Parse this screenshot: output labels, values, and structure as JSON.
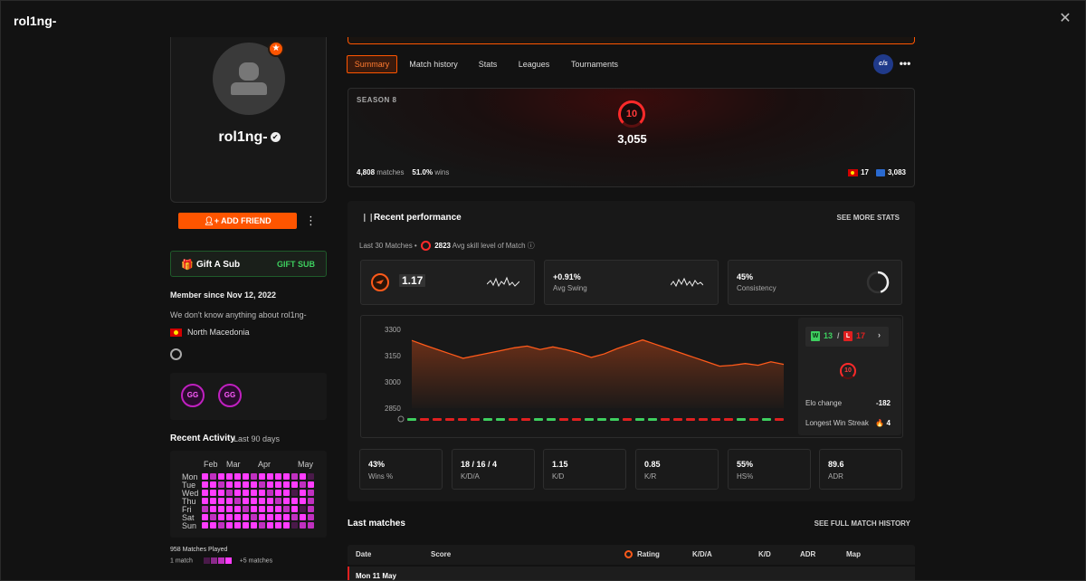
{
  "window": {
    "title": "rol1ng-",
    "close_glyph": "✕"
  },
  "profile": {
    "name": "rol1ng-",
    "verified_glyph": "✔",
    "badge_glyph": "★",
    "add_friend_label": "ADD FRIEND",
    "add_friend_icon": "user-plus-icon",
    "more_glyph": "⋮"
  },
  "gift": {
    "icon_glyph": "🎁",
    "label": "Gift A Sub",
    "action": "GIFT SUB"
  },
  "member_since": "Member since Nov 12, 2022",
  "about": "We don't know anything about rol1ng-",
  "country": "North Macedonia",
  "badges": [
    "GG",
    "GG"
  ],
  "recent_activity": {
    "title": "Recent Activity",
    "subtitle": "Last 90 days",
    "months": [
      "Feb",
      "Mar",
      "Apr",
      "May"
    ],
    "days": [
      "Mon",
      "Tue",
      "Wed",
      "Thu",
      "Fri",
      "Sat",
      "Sun"
    ],
    "matches_played": "958 Matches Played",
    "legend_low": "1 match",
    "legend_high": "+5 matches"
  },
  "tabs": [
    "Summary",
    "Match history",
    "Stats",
    "Leagues",
    "Tournaments"
  ],
  "game_logo": "c/s",
  "more_glyph": "•••",
  "season": {
    "label": "SEASON 8",
    "level": "10",
    "elo": "3,055",
    "matches_value": "4,808",
    "matches_label": "matches",
    "wins_value": "51.0%",
    "wins_label": "wins",
    "rank_country": "17",
    "rank_world": "3,083"
  },
  "performance": {
    "title": "Recent performance",
    "see_more": "SEE MORE STATS",
    "sub_prefix": "Last 30 Matches •",
    "avg_value": "2823",
    "avg_label": "Avg skill level of Match",
    "info_glyph": "ⓘ",
    "metrics": [
      {
        "value": "1.17",
        "label": ""
      },
      {
        "value": "+0.91%",
        "label": "Avg Swing"
      },
      {
        "value": "45%",
        "label": "Consistency"
      }
    ],
    "side": {
      "wins": "13",
      "losses": "17",
      "w_tag": "W",
      "l_tag": "L",
      "sep": "/",
      "arrow": "›",
      "level": "10",
      "elo_change_label": "Elo change",
      "elo_change_value": "-182",
      "streak_label": "Longest Win Streak",
      "streak_value": "🔥 4"
    },
    "stats": [
      {
        "value": "43%",
        "label": "Wins %"
      },
      {
        "value": "18 / 16 / 4",
        "label": "K/D/A"
      },
      {
        "value": "1.15",
        "label": "K/D"
      },
      {
        "value": "0.85",
        "label": "K/R"
      },
      {
        "value": "55%",
        "label": "HS%"
      },
      {
        "value": "89.6",
        "label": "ADR"
      }
    ]
  },
  "chart_data": {
    "type": "area",
    "title": "",
    "xlabel": "",
    "ylabel": "",
    "yticks": [
      "3300",
      "3150",
      "3000",
      "2850"
    ],
    "ylim": [
      2850,
      3300
    ],
    "values": [
      3237,
      3210,
      3185,
      3160,
      3135,
      3150,
      3165,
      3180,
      3195,
      3205,
      3185,
      3200,
      3185,
      3165,
      3140,
      3160,
      3190,
      3215,
      3240,
      3215,
      3190,
      3165,
      3140,
      3115,
      3090,
      3095,
      3105,
      3095,
      3115,
      3100
    ],
    "results": [
      "W",
      "L",
      "L",
      "L",
      "L",
      "L",
      "W",
      "W",
      "L",
      "L",
      "W",
      "W",
      "L",
      "L",
      "W",
      "W",
      "W",
      "L",
      "W",
      "W",
      "L",
      "L",
      "L",
      "L",
      "L",
      "L",
      "W",
      "L",
      "W",
      "L"
    ],
    "colors": {
      "line": "#ff5a1a",
      "win": "#3ecf5f",
      "loss": "#e02020"
    }
  },
  "last_matches": {
    "title": "Last matches",
    "see_all": "SEE FULL MATCH HISTORY",
    "headers": [
      "Date",
      "Score",
      "Rating",
      "K/D/A",
      "K/D",
      "ADR",
      "Map"
    ],
    "first_row_date": "Mon 11 May"
  }
}
